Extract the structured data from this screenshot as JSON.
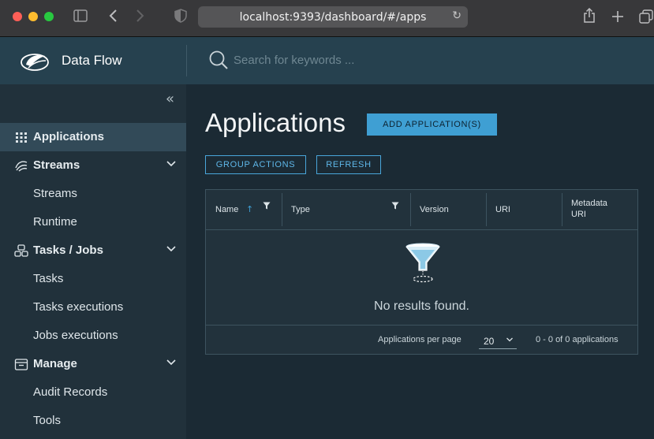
{
  "browser": {
    "url": "localhost:9393/dashboard/#/apps"
  },
  "app": {
    "title": "Data Flow",
    "search_placeholder": "Search for keywords ..."
  },
  "sidebar": {
    "items": [
      {
        "label": "Applications",
        "icon": "grid-icon",
        "active": true
      },
      {
        "label": "Streams",
        "icon": "streams-icon",
        "expandable": true
      },
      {
        "label": "Streams",
        "sub": true
      },
      {
        "label": "Runtime",
        "sub": true
      },
      {
        "label": "Tasks / Jobs",
        "icon": "tasks-icon",
        "expandable": true
      },
      {
        "label": "Tasks",
        "sub": true
      },
      {
        "label": "Tasks executions",
        "sub": true
      },
      {
        "label": "Jobs executions",
        "sub": true
      },
      {
        "label": "Manage",
        "icon": "manage-icon",
        "expandable": true
      },
      {
        "label": "Audit Records",
        "sub": true
      },
      {
        "label": "Tools",
        "sub": true
      }
    ]
  },
  "main": {
    "title": "Applications",
    "add_button": "ADD APPLICATION(S)",
    "group_actions": "GROUP ACTIONS",
    "refresh": "REFRESH",
    "grid": {
      "columns": [
        "Name",
        "Type",
        "Version",
        "URI",
        "Metadata URI"
      ],
      "metadata_line1": "Metadata",
      "metadata_line2": "URI",
      "empty_text": "No results found.",
      "per_page_label": "Applications per page",
      "per_page_value": "20",
      "range_text": "0 - 0 of 0 applications"
    }
  },
  "colors": {
    "accent": "#3f9fd3",
    "header": "#26414f",
    "sidebar": "#21313b",
    "background": "#1b2a34"
  }
}
